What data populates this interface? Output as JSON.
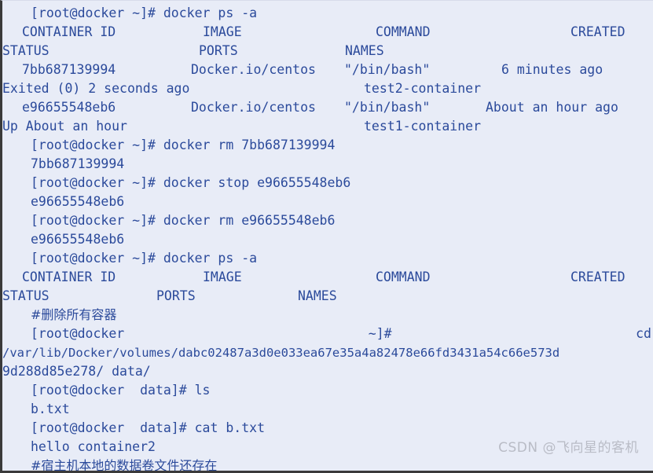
{
  "terminal": {
    "background_color": "#e8ecf7",
    "text_color": "#2b4a9b",
    "lines": [
      {
        "id": "l01",
        "type": "prompt",
        "text": "[root@docker ~]# docker ps -a"
      },
      {
        "id": "l02",
        "type": "header",
        "col1": "CONTAINER ID",
        "col2": "IMAGE",
        "col3": "COMMAND",
        "col4": "CREATED"
      },
      {
        "id": "l03",
        "type": "header2",
        "col1": "STATUS",
        "col2": "PORTS",
        "col3": "NAMES"
      },
      {
        "id": "l04",
        "type": "row",
        "col1": "7bb687139994",
        "col2": "Docker.io/centos",
        "col3": "\"/bin/bash\"",
        "col4": "6 minutes ago"
      },
      {
        "id": "l05",
        "type": "row2",
        "col1": "Exited (0) 2 seconds ago",
        "col2": "test2-container"
      },
      {
        "id": "l06",
        "type": "row",
        "col1": "e96655548eb6",
        "col2": "Docker.io/centos",
        "col3": "\"/bin/bash\"",
        "col4": "About an hour ago"
      },
      {
        "id": "l07",
        "type": "row2",
        "col1": "Up About an hour",
        "col2": "test1-container"
      },
      {
        "id": "l08",
        "type": "prompt",
        "text": "[root@docker ~]# docker rm 7bb687139994"
      },
      {
        "id": "l09",
        "type": "output",
        "text": "7bb687139994"
      },
      {
        "id": "l10",
        "type": "prompt",
        "text": "[root@docker ~]# docker stop e96655548eb6"
      },
      {
        "id": "l11",
        "type": "output",
        "text": "e96655548eb6"
      },
      {
        "id": "l12",
        "type": "prompt",
        "text": "[root@docker ~]# docker rm e96655548eb6"
      },
      {
        "id": "l13",
        "type": "output",
        "text": "e96655548eb6"
      },
      {
        "id": "l14",
        "type": "prompt",
        "text": "[root@docker ~]# docker ps -a"
      },
      {
        "id": "l15",
        "type": "header",
        "col1": "CONTAINER ID",
        "col2": "IMAGE",
        "col3": "COMMAND",
        "col4": "CREATED"
      },
      {
        "id": "l16",
        "type": "header3",
        "col1": "STATUS",
        "col2": "PORTS",
        "col3": "NAMES"
      },
      {
        "id": "l17",
        "type": "comment",
        "text": "#删除所有容器"
      },
      {
        "id": "l18",
        "type": "justified",
        "left": "[root@docker",
        "center": "~]#",
        "right": "cd"
      },
      {
        "id": "l19",
        "type": "wrap",
        "text": "/var/lib/Docker/volumes/dabc02487a3d0e033ea67e35a4a82478e66fd3431a54c66e573d"
      },
      {
        "id": "l20",
        "type": "wrap",
        "text": "9d288d85e278/ data/"
      },
      {
        "id": "l21",
        "type": "prompt",
        "text": "[root@docker  data]# ls"
      },
      {
        "id": "l22",
        "type": "output",
        "text": "b.txt"
      },
      {
        "id": "l23",
        "type": "prompt",
        "text": "[root@docker  data]# cat b.txt"
      },
      {
        "id": "l24",
        "type": "output",
        "text": "hello container2"
      },
      {
        "id": "l25",
        "type": "comment",
        "text": "#宿主机本地的数据卷文件还存在"
      }
    ]
  },
  "watermark": {
    "text": "CSDN @飞向星的客机",
    "color": "#b9bcc6"
  }
}
